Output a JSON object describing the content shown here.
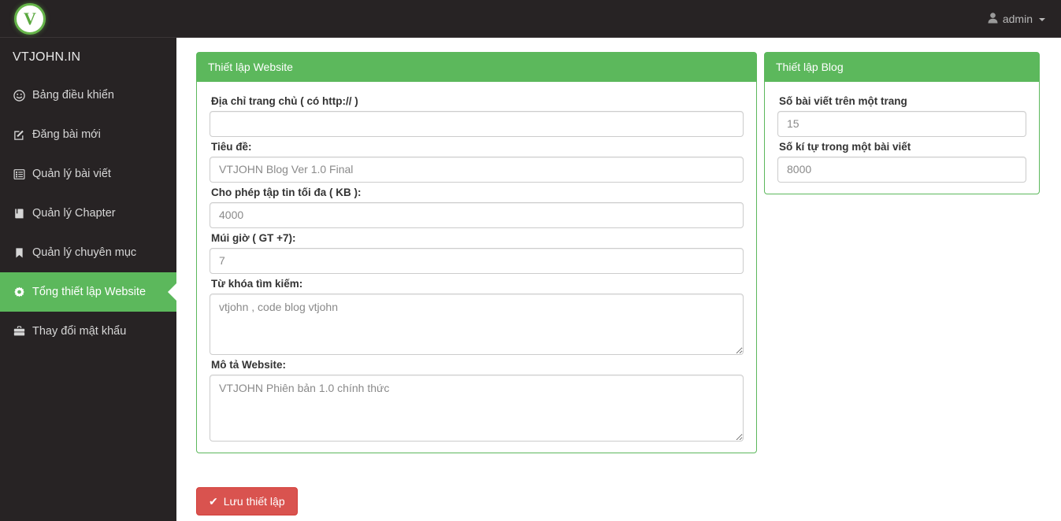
{
  "navbar": {
    "logo_letter": "V",
    "logo_icon": "circle-v-logo",
    "user_icon": "user-icon",
    "user_label": "admin",
    "caret_icon": "caret-down-icon"
  },
  "sidebar": {
    "brand": "VTJOHN.IN",
    "items": [
      {
        "label": "Bảng điều khiển",
        "icon": "dashboard-icon",
        "active": false
      },
      {
        "label": "Đăng bài mới",
        "icon": "edit-pencil-square-icon",
        "active": false
      },
      {
        "label": "Quản lý bài viết",
        "icon": "list-alt-icon",
        "active": false
      },
      {
        "label": "Quản lý Chapter",
        "icon": "book-icon",
        "active": false
      },
      {
        "label": "Quản lý chuyên mục",
        "icon": "bookmark-icon",
        "active": false
      },
      {
        "label": "Tổng thiết lập Website",
        "icon": "gear-icon",
        "active": true
      },
      {
        "label": "Thay đổi mật khẩu",
        "icon": "briefcase-icon",
        "active": false
      }
    ]
  },
  "website_panel": {
    "title": "Thiết lập Website",
    "fields": {
      "homepage": {
        "label": "Địa chỉ trang chủ ( có http:// )",
        "value": "",
        "placeholder": ""
      },
      "site_title": {
        "label": "Tiêu đề:",
        "value": "VTJOHN Blog Ver 1.0 Final",
        "placeholder": "VTJOHN Blog Ver 1.0 Final"
      },
      "max_filesize": {
        "label": "Cho phép tập tin tối đa ( KB ):",
        "value": "4000",
        "placeholder": "4000"
      },
      "timezone": {
        "label": "Múi giờ ( GT +7):",
        "value": "7",
        "placeholder": "7"
      },
      "keywords": {
        "label": "Từ khóa tìm kiếm:",
        "value": "vtjohn , code blog vtjohn",
        "placeholder": "vtjohn , code blog vtjohn"
      },
      "description": {
        "label": "Mô tả Website:",
        "value": "VTJOHN Phiên bản 1.0 chính thức",
        "placeholder": "VTJOHN Phiên bản 1.0 chính thức"
      }
    }
  },
  "blog_panel": {
    "title": "Thiết lập Blog",
    "fields": {
      "posts_per_page": {
        "label": "Số bài viết trên một trang",
        "value": "15",
        "placeholder": "15"
      },
      "chars_per_post": {
        "label": "Số kí tự trong một bài viết",
        "value": "8000",
        "placeholder": "8000"
      }
    }
  },
  "save_button": {
    "label": "Lưu thiết lập",
    "icon": "check-icon",
    "check_glyph": "✔"
  },
  "colors": {
    "brand_green": "#5cb85c",
    "sidebar_dark": "#272324",
    "danger_red": "#d9534f"
  }
}
